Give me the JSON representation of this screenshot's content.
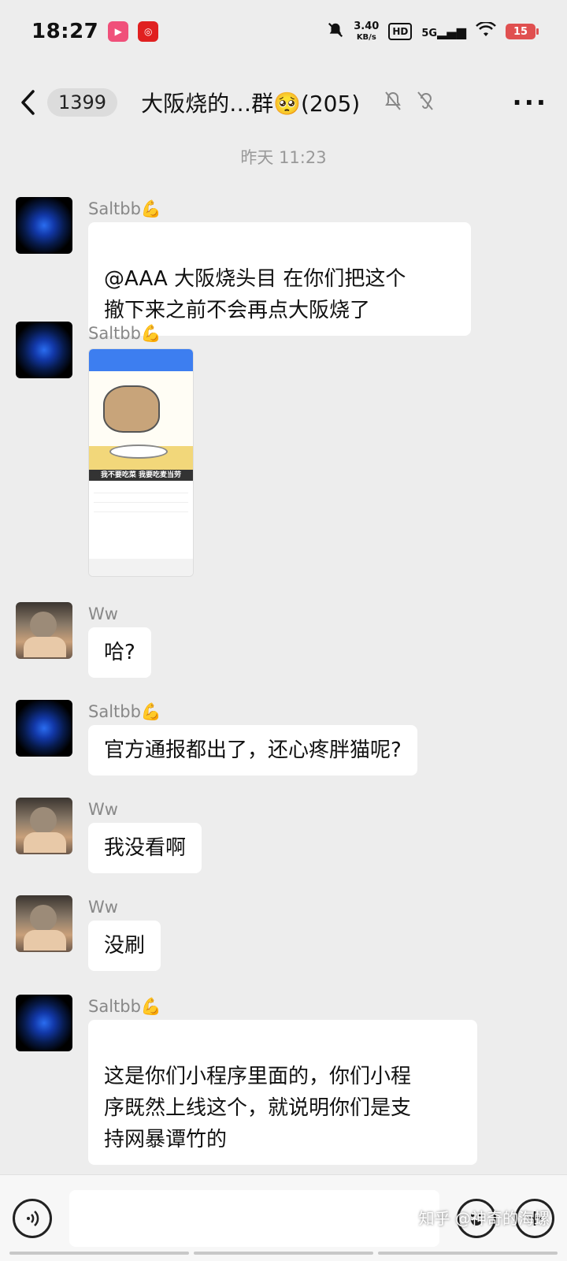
{
  "status_bar": {
    "time": "18:27",
    "net_speed": "3.40",
    "net_unit": "KB/s",
    "hd": "HD",
    "network": "5G",
    "battery": "15"
  },
  "header": {
    "unread_count": "1399",
    "title": "大阪烧的…群🥺(205)"
  },
  "timestamp": "昨天 11:23",
  "messages": [
    {
      "sender": "Saltbb💪",
      "text": "@AAA 大阪烧头目  在你们把这个\n撤下来之前不会再点大阪烧了"
    },
    {
      "sender": "Saltbb💪",
      "image_caption": "我不要吃菜 我要吃麦当劳"
    },
    {
      "sender": "Ww",
      "text": "哈?"
    },
    {
      "sender": "Saltbb💪",
      "text": "官方通报都出了，还心疼胖猫呢?"
    },
    {
      "sender": "Ww",
      "text": "我没看啊"
    },
    {
      "sender": "Ww",
      "text": "没刷"
    },
    {
      "sender": "Saltbb💪",
      "text": "这是你们小程序里面的，你们小程\n序既然上线这个，就说明你们是支\n持网暴谭竹的"
    }
  ],
  "input": {
    "placeholder": ""
  },
  "watermark": "知乎 @神奇的海螺",
  "colors": {
    "background": "#ededed",
    "bubble": "#ffffff",
    "battery": "#e05050"
  }
}
